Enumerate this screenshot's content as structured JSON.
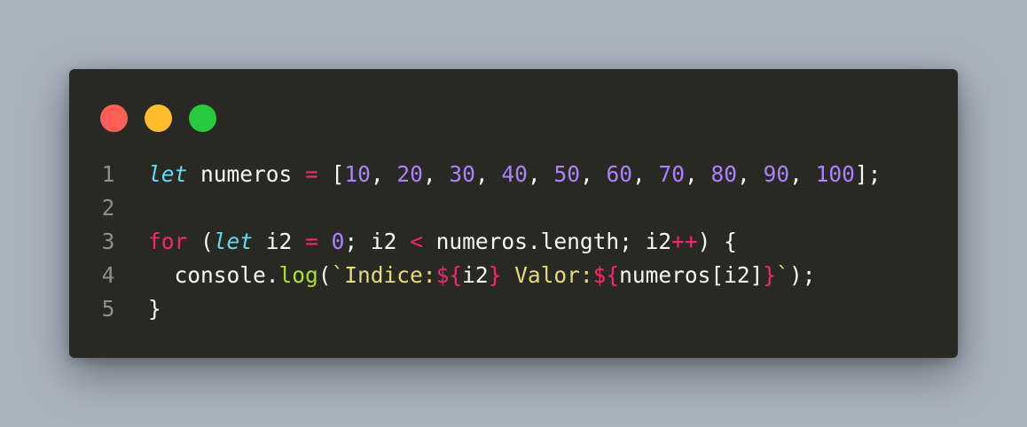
{
  "window": {
    "controls": [
      {
        "name": "close",
        "color": "#ff5f56"
      },
      {
        "name": "minimize",
        "color": "#ffbd2e"
      },
      {
        "name": "maximize",
        "color": "#27c93f"
      }
    ]
  },
  "editor": {
    "lines": [
      {
        "number": "1",
        "tokens": [
          {
            "t": "let",
            "c": "kw-let"
          },
          {
            "t": " numeros ",
            "c": "plain"
          },
          {
            "t": "=",
            "c": "op"
          },
          {
            "t": " [",
            "c": "plain"
          },
          {
            "t": "10",
            "c": "num"
          },
          {
            "t": ", ",
            "c": "plain"
          },
          {
            "t": "20",
            "c": "num"
          },
          {
            "t": ", ",
            "c": "plain"
          },
          {
            "t": "30",
            "c": "num"
          },
          {
            "t": ", ",
            "c": "plain"
          },
          {
            "t": "40",
            "c": "num"
          },
          {
            "t": ", ",
            "c": "plain"
          },
          {
            "t": "50",
            "c": "num"
          },
          {
            "t": ", ",
            "c": "plain"
          },
          {
            "t": "60",
            "c": "num"
          },
          {
            "t": ", ",
            "c": "plain"
          },
          {
            "t": "70",
            "c": "num"
          },
          {
            "t": ", ",
            "c": "plain"
          },
          {
            "t": "80",
            "c": "num"
          },
          {
            "t": ", ",
            "c": "plain"
          },
          {
            "t": "90",
            "c": "num"
          },
          {
            "t": ", ",
            "c": "plain"
          },
          {
            "t": "100",
            "c": "num"
          },
          {
            "t": "];",
            "c": "plain"
          }
        ]
      },
      {
        "number": "2",
        "tokens": []
      },
      {
        "number": "3",
        "tokens": [
          {
            "t": "for",
            "c": "kw"
          },
          {
            "t": " (",
            "c": "plain"
          },
          {
            "t": "let",
            "c": "kw-let"
          },
          {
            "t": " i2 ",
            "c": "plain"
          },
          {
            "t": "=",
            "c": "op"
          },
          {
            "t": " ",
            "c": "plain"
          },
          {
            "t": "0",
            "c": "num"
          },
          {
            "t": "; i2 ",
            "c": "plain"
          },
          {
            "t": "<",
            "c": "op"
          },
          {
            "t": " numeros.length; i2",
            "c": "plain"
          },
          {
            "t": "++",
            "c": "op"
          },
          {
            "t": ") {",
            "c": "plain"
          }
        ]
      },
      {
        "number": "4",
        "tokens": [
          {
            "t": "  console.",
            "c": "plain"
          },
          {
            "t": "log",
            "c": "fn"
          },
          {
            "t": "(",
            "c": "plain"
          },
          {
            "t": "`Indice:",
            "c": "str"
          },
          {
            "t": "${",
            "c": "tpl"
          },
          {
            "t": "i2",
            "c": "plain"
          },
          {
            "t": "}",
            "c": "tpl"
          },
          {
            "t": " Valor:",
            "c": "str"
          },
          {
            "t": "${",
            "c": "tpl"
          },
          {
            "t": "numeros[i2]",
            "c": "plain"
          },
          {
            "t": "}",
            "c": "tpl"
          },
          {
            "t": "`",
            "c": "str"
          },
          {
            "t": ");",
            "c": "plain"
          }
        ]
      },
      {
        "number": "5",
        "tokens": [
          {
            "t": "}",
            "c": "plain"
          }
        ]
      }
    ]
  }
}
